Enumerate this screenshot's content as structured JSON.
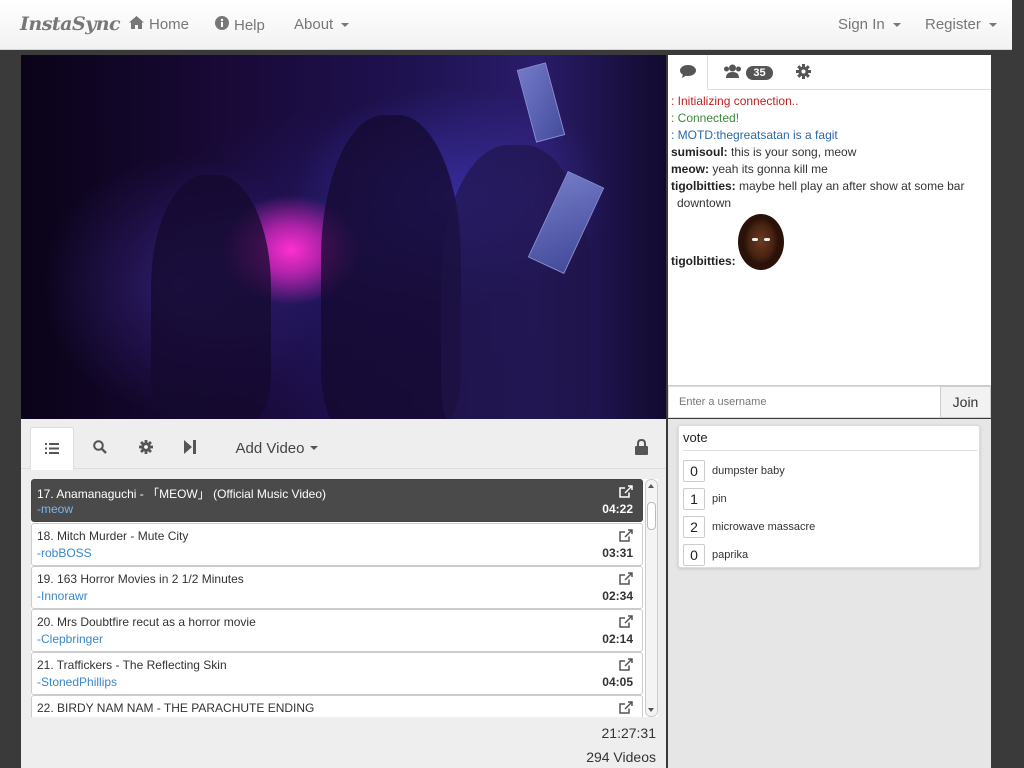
{
  "navbar": {
    "brand": "InstaSync",
    "home": "Home",
    "help": "Help",
    "about": "About",
    "signin": "Sign In",
    "register": "Register"
  },
  "chat": {
    "user_count": "35",
    "messages": [
      {
        "type": "system",
        "text": ": Initializing connection.."
      },
      {
        "type": "system",
        "text": ": Connected!"
      },
      {
        "type": "system",
        "text": ": MOTD:thegreatsatan is a fagit"
      },
      {
        "type": "user",
        "user": "sumisoul:",
        "text": " this is your song, meow"
      },
      {
        "type": "user",
        "user": "meow:",
        "text": " yeah its gonna kill me"
      },
      {
        "type": "user",
        "user": "tigolbitties:",
        "text": " maybe hell play an after show at some bar downtown"
      },
      {
        "type": "emote",
        "user": "tigolbitties:",
        "emote": "face-emote"
      }
    ],
    "username_placeholder": "Enter a username",
    "join_label": "Join"
  },
  "poll": {
    "title": "vote",
    "options": [
      {
        "votes": "0",
        "label": "dumpster baby"
      },
      {
        "votes": "1",
        "label": "pin"
      },
      {
        "votes": "2",
        "label": "microwave massacre"
      },
      {
        "votes": "0",
        "label": "paprika"
      }
    ]
  },
  "playlist": {
    "add_video_label": "Add Video",
    "items": [
      {
        "title": "17. Anamanaguchi - 「MEOW」 (Official Music Video)",
        "user": "-meow",
        "duration": "04:22",
        "active": true
      },
      {
        "title": "18. Mitch Murder - Mute City",
        "user": "-robBOSS",
        "duration": "03:31"
      },
      {
        "title": "19. 163 Horror Movies in 2 1/2 Minutes",
        "user": "-Innorawr",
        "duration": "02:34"
      },
      {
        "title": "20. Mrs Doubtfire recut as a horror movie",
        "user": "-Clepbringer",
        "duration": "02:14"
      },
      {
        "title": "21. Traffickers - The Reflecting Skin",
        "user": "-StonedPhillips",
        "duration": "04:05"
      },
      {
        "title": "22. BIRDY NAM NAM - THE PARACHUTE ENDING",
        "user": "",
        "duration": ""
      }
    ],
    "total_time": "21:27:31",
    "video_count": "294 Videos"
  },
  "colors": {
    "link_blue": "#3a86c8",
    "system_red": "#bb2222",
    "system_green": "#3a8a3a",
    "system_blue": "#2a6aa8",
    "active_item_bg": "#4a4a4a"
  },
  "icons": {
    "home": "home-icon",
    "help": "info-circle-icon",
    "chat_tab": "comment-icon",
    "users_tab": "users-icon",
    "settings_tab": "gear-icon",
    "playlist_tab": "list-icon",
    "search_tab": "search-icon",
    "skip_tab": "skip-icon",
    "lock": "lock-icon",
    "external_link": "external-link-icon"
  }
}
